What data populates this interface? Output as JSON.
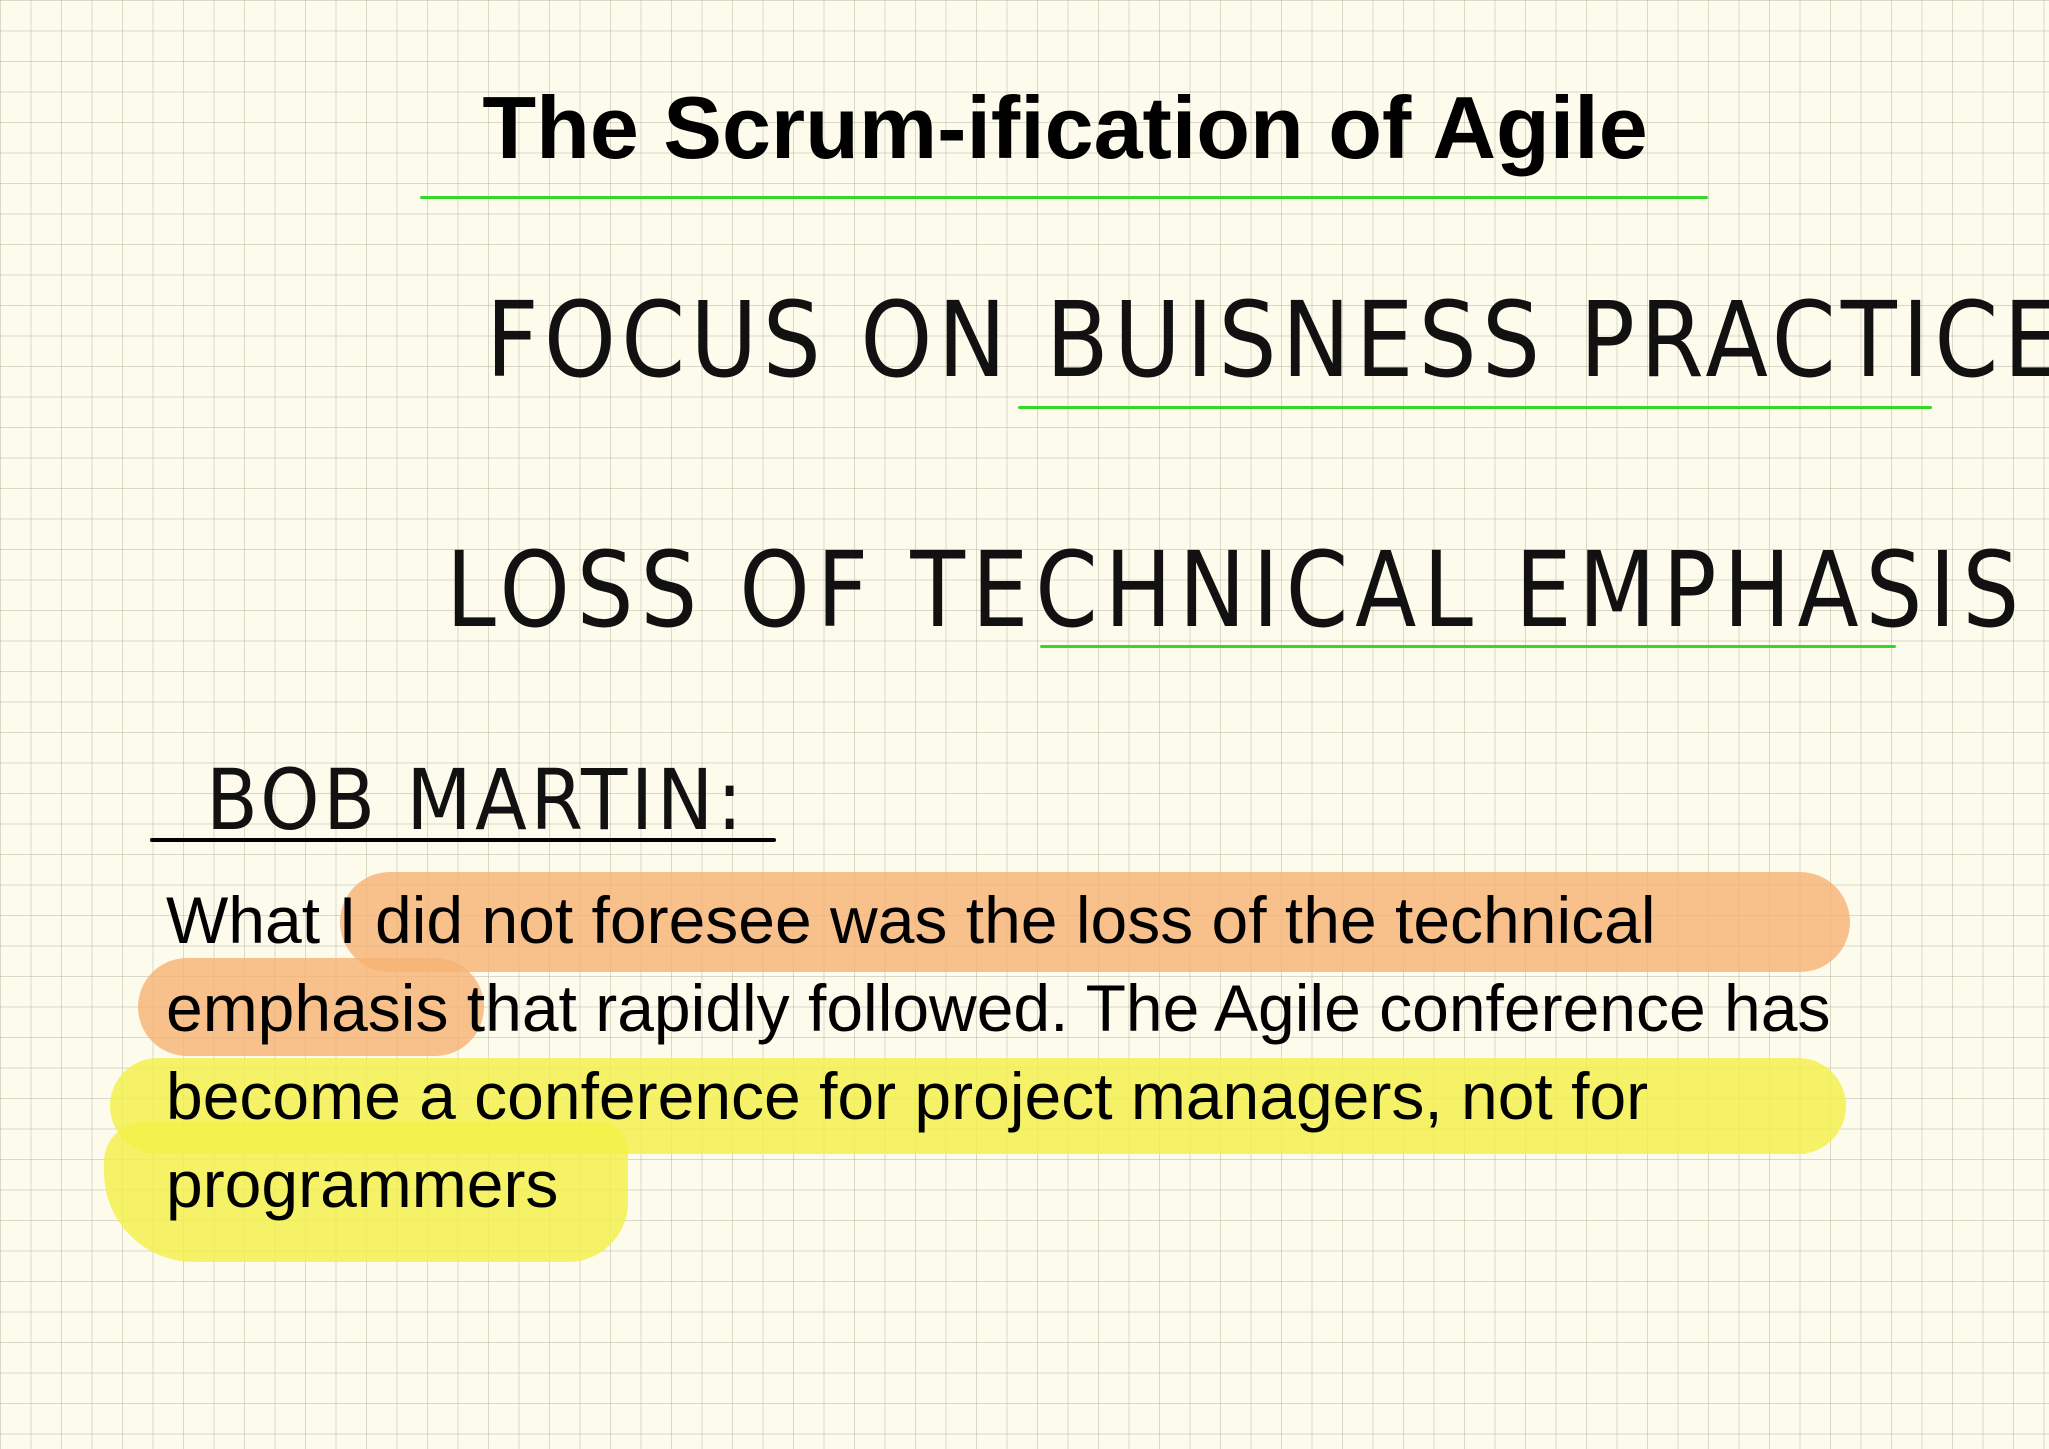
{
  "slide": {
    "title": "The Scrum-ification of Agile",
    "handwritten": {
      "line1": "Focus ON Buisness Practices",
      "line2": "Loss of Technical Emphasis",
      "attribution": "Bob Martin:"
    },
    "quote_lines": [
      "What I did not foresee was the loss of the technical",
      "emphasis that rapidly followed. The Agile conference has",
      "become a conference for project managers, not for",
      "programmers"
    ]
  },
  "colors": {
    "background": "#fdfbec",
    "underline_green": "#35d82a",
    "highlight_orange": "#f6b273",
    "highlight_yellow": "#f2f046"
  }
}
